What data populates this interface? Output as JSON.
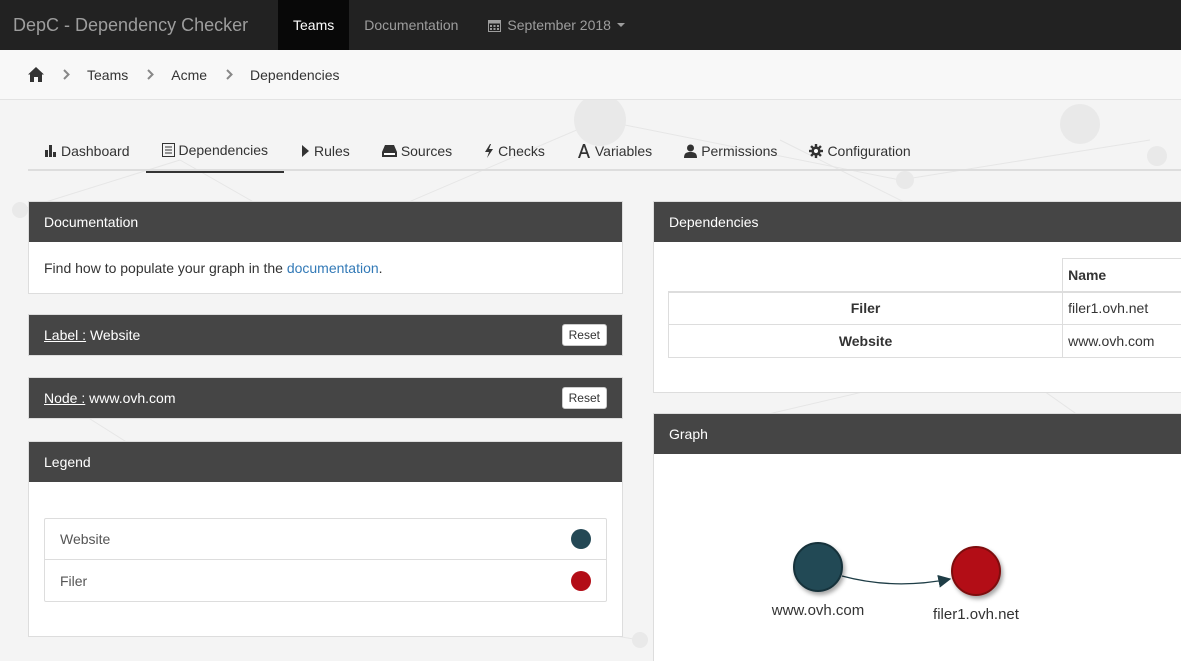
{
  "navbar": {
    "brand": "DepC - Dependency Checker",
    "items": [
      {
        "label": "Teams",
        "active": true
      },
      {
        "label": "Documentation",
        "active": false
      },
      {
        "label": "September 2018",
        "icon": "calendar-icon",
        "dropdown": true
      }
    ]
  },
  "breadcrumb": {
    "home_icon": "home-icon",
    "items": [
      "Teams",
      "Acme",
      "Dependencies"
    ]
  },
  "tabs": [
    {
      "label": "Dashboard",
      "icon": "bar-chart-icon"
    },
    {
      "label": "Dependencies",
      "icon": "list-icon",
      "active": true
    },
    {
      "label": "Rules",
      "icon": "play-icon"
    },
    {
      "label": "Sources",
      "icon": "hdd-icon"
    },
    {
      "label": "Checks",
      "icon": "flash-icon"
    },
    {
      "label": "Variables",
      "icon": "font-icon"
    },
    {
      "label": "Permissions",
      "icon": "user-icon"
    },
    {
      "label": "Configuration",
      "icon": "cog-icon"
    }
  ],
  "documentation_panel": {
    "title": "Documentation",
    "text_before": "Find how to populate your graph in the ",
    "link": "documentation",
    "text_after": "."
  },
  "label_panel": {
    "key": "Label :",
    "value": "Website",
    "reset": "Reset"
  },
  "node_panel": {
    "key": "Node :",
    "value": "www.ovh.com",
    "reset": "Reset"
  },
  "legend_panel": {
    "title": "Legend",
    "items": [
      {
        "label": "Website",
        "color": "#244855"
      },
      {
        "label": "Filer",
        "color": "#b30d17"
      }
    ]
  },
  "dependencies_panel": {
    "title": "Dependencies",
    "column_header": "Name",
    "rows": [
      {
        "label": "Filer",
        "name": "filer1.ovh.net"
      },
      {
        "label": "Website",
        "name": "www.ovh.com"
      }
    ]
  },
  "graph_panel": {
    "title": "Graph",
    "nodes": [
      {
        "label": "www.ovh.com",
        "color": "#244855"
      },
      {
        "label": "filer1.ovh.net",
        "color": "#b30d17"
      }
    ]
  },
  "colors": {
    "navbar": "#222222",
    "panel_heading": "#454545",
    "link": "#337ab7"
  }
}
